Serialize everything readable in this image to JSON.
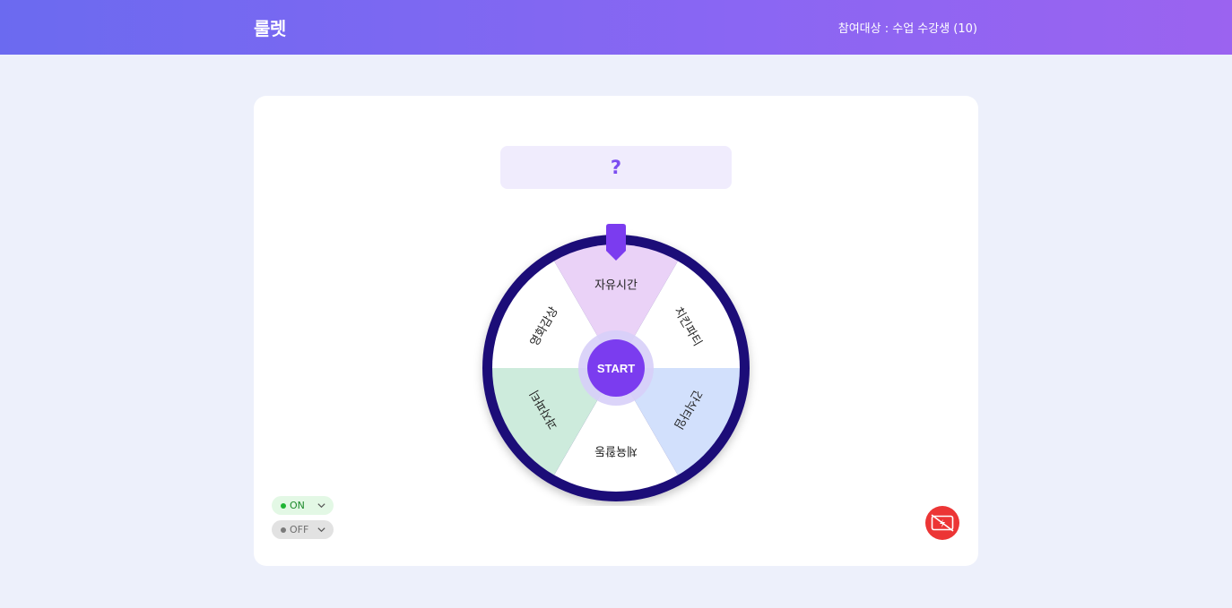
{
  "header": {
    "title": "룰렛",
    "participants": "참여대상 : 수업 수강생 (10)"
  },
  "result": {
    "text": "?"
  },
  "roulette": {
    "start_label": "START",
    "segments": [
      {
        "label": "자유시간",
        "color": "#ead2f7"
      },
      {
        "label": "치킨파티",
        "color": "#ffffff"
      },
      {
        "label": "간식타임",
        "color": "#d2e0fc"
      },
      {
        "label": "체육활동",
        "color": "#ffffff"
      },
      {
        "label": "과자파티",
        "color": "#cdebdc"
      },
      {
        "label": "영화감상",
        "color": "#ffffff"
      }
    ],
    "rim_color": "#1f0f78",
    "pointer_color": "#7b3cef",
    "start_color": "#7b3cef"
  },
  "toggles": {
    "on_label": "ON",
    "off_label": "OFF"
  },
  "icons": {
    "fab": "screen-off-icon",
    "chevron": "chevron-down-icon"
  }
}
